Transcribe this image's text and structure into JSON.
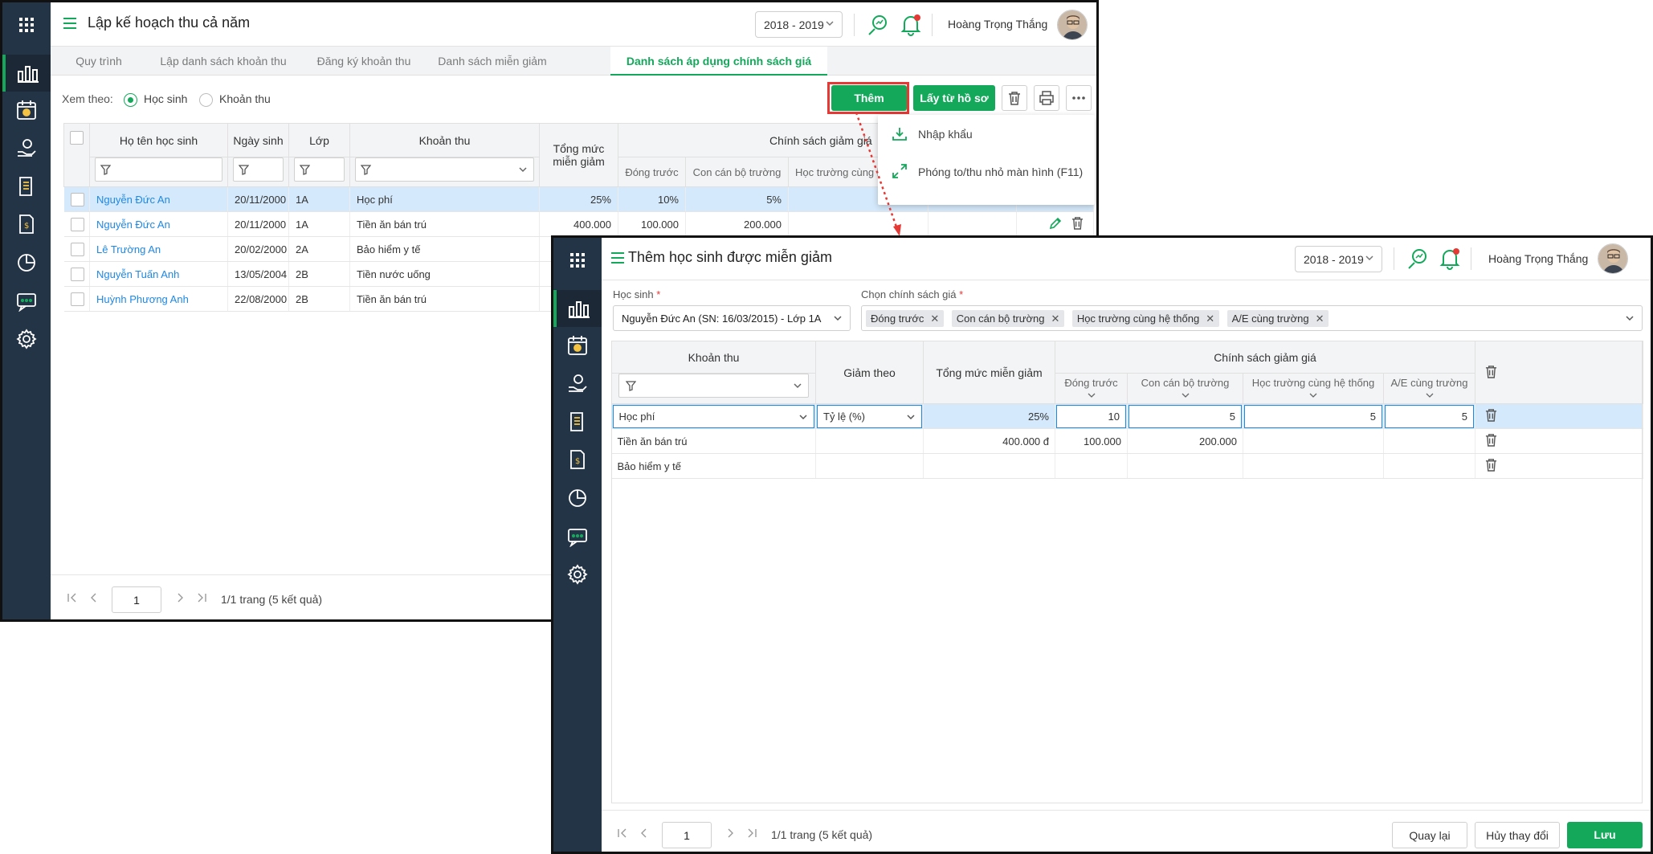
{
  "win1": {
    "title": "Lập kế hoạch thu cả năm",
    "year": "2018 - 2019",
    "user": "Hoàng Trọng Thắng",
    "tabs": [
      "Quy trình",
      "Lập danh sách khoản thu",
      "Đăng ký khoản thu",
      "Danh sách miễn giảm",
      "Danh sách áp dụng chính sách giá"
    ],
    "active_tab": 4,
    "view_by_label": "Xem theo:",
    "view_options": [
      "Học sinh",
      "Khoản thu"
    ],
    "selected_view": "Học sinh",
    "buttons": {
      "add": "Thêm",
      "from_profile": "Lấy từ hồ sơ"
    },
    "dropdown": [
      "Nhập khẩu",
      "Phóng to/thu nhỏ màn hình (F11)"
    ],
    "columns": {
      "name": "Họ tên học sinh",
      "dob": "Ngày sinh",
      "class": "Lớp",
      "fee": "Khoản thu",
      "total": "Tổng mức miễn giảm",
      "policy": "Chính sách giảm giá"
    },
    "subcolumns": [
      "Đóng trước",
      "Con cán bộ trường",
      "Học trường cùng hệ thống"
    ],
    "rows": [
      {
        "name": "Nguyễn Đức An",
        "dob": "20/11/2000",
        "class": "1A",
        "fee": "Học phí",
        "total": "25%",
        "s1": "10%",
        "s2": "5%",
        "s3": ""
      },
      {
        "name": "Nguyễn Đức An",
        "dob": "20/11/2000",
        "class": "1A",
        "fee": "Tiền ăn bán trú",
        "total": "400.000",
        "s1": "100.000",
        "s2": "200.000",
        "s3": ""
      },
      {
        "name": "Lê Trường An",
        "dob": "20/02/2000",
        "class": "2A",
        "fee": "Bảo hiểm y tế",
        "total": "",
        "s1": "",
        "s2": "",
        "s3": ""
      },
      {
        "name": "Nguyễn Tuấn Anh",
        "dob": "13/05/2004",
        "class": "2B",
        "fee": "Tiền nước uống",
        "total": "",
        "s1": "",
        "s2": "",
        "s3": ""
      },
      {
        "name": "Huỳnh Phương Anh",
        "dob": "22/08/2000",
        "class": "2B",
        "fee": "Tiền ăn bán trú",
        "total": "",
        "s1": "",
        "s2": "",
        "s3": ""
      }
    ],
    "page": "1",
    "page_info": "1/1 trang (5 kết quả)"
  },
  "win2": {
    "title": "Thêm học sinh được miễn giảm",
    "year": "2018 - 2019",
    "user": "Hoàng Trọng Thắng",
    "student_label": "Học sinh",
    "student_value": "Nguyễn Đức An (SN: 16/03/2015) - Lớp 1A",
    "policy_label": "Chọn chính sách giá",
    "policy_tags": [
      "Đóng trước",
      "Con cán bộ trường",
      "Học trường cùng hệ thống",
      "A/E cùng trường"
    ],
    "columns": {
      "fee": "Khoản thu",
      "reduce_by": "Giảm theo",
      "total": "Tổng mức miễn giảm",
      "policy": "Chính sách giảm giá"
    },
    "subcolumns": [
      "Đóng trước",
      "Con cán bộ trường",
      "Học trường cùng hệ thống",
      "A/E cùng trường"
    ],
    "rows": [
      {
        "fee": "Học phí",
        "reduce_by": "Tỷ lệ (%)",
        "total": "25%",
        "s1": "10",
        "s2": "5",
        "s3": "5",
        "s4": "5"
      },
      {
        "fee": "Tiền ăn bán trú",
        "reduce_by": "",
        "total": "400.000 đ",
        "s1": "100.000",
        "s2": "200.000",
        "s3": "",
        "s4": ""
      },
      {
        "fee": "Bảo hiểm y tế",
        "reduce_by": "",
        "total": "",
        "s1": "",
        "s2": "",
        "s3": "",
        "s4": ""
      }
    ],
    "page": "1",
    "page_info": "1/1 trang (5 kết quả)",
    "buttons": {
      "back": "Quay lại",
      "discard": "Hủy thay đổi",
      "save": "Lưu"
    }
  },
  "colors": {
    "brand_green": "#14a85b",
    "sidebar": "#243447",
    "link_blue": "#1e88e5",
    "selected_row": "#d4e9fb",
    "highlight_red": "#e53935"
  }
}
